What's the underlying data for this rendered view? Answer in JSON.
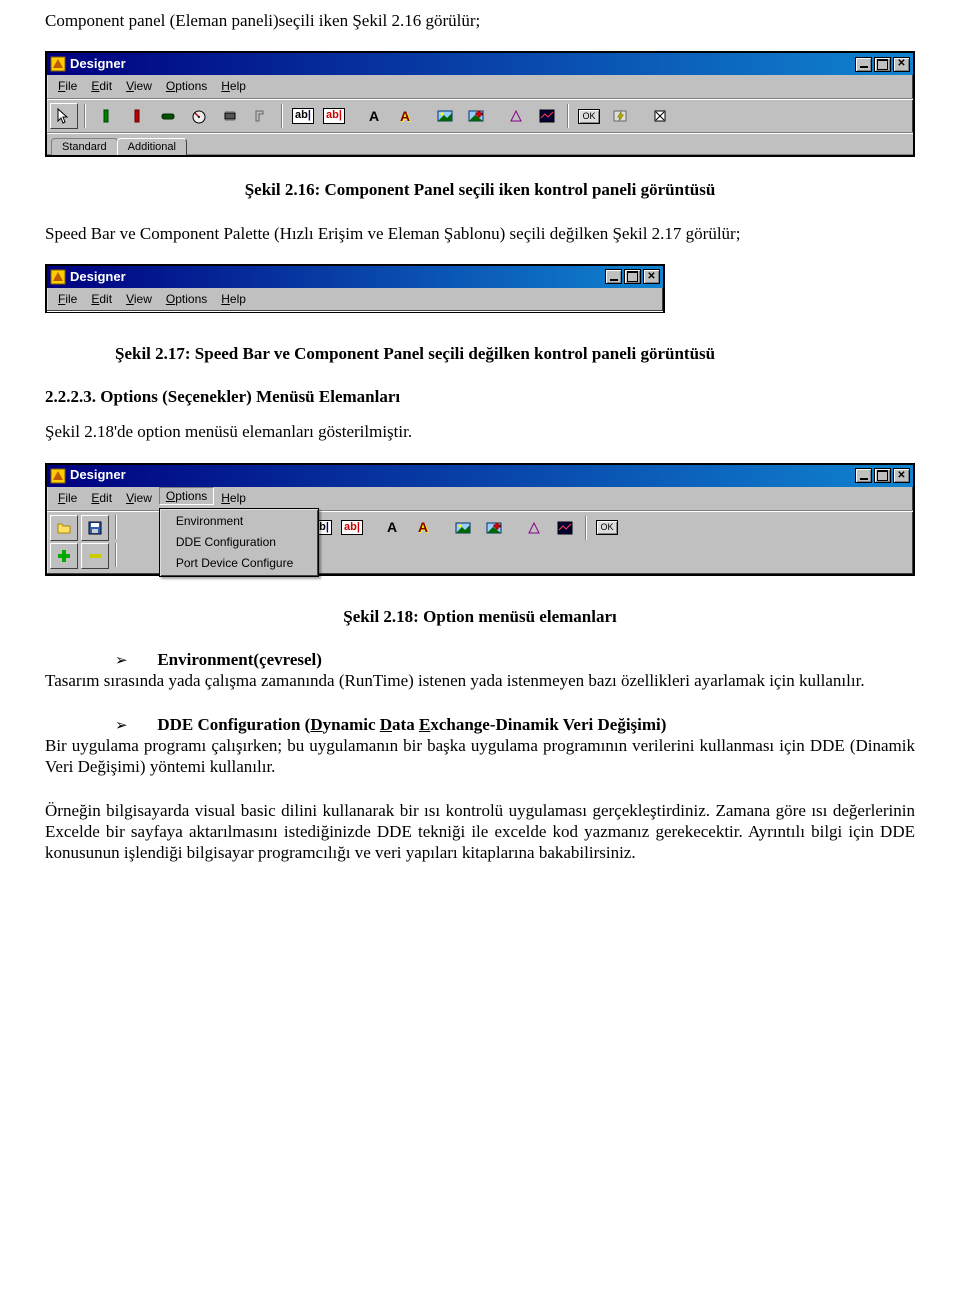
{
  "text": {
    "intro1": "Component panel (Eleman paneli)seçili iken Şekil 2.16 görülür;",
    "caption1": "Şekil 2.16: Component Panel  seçili iken kontrol paneli görüntüsü",
    "para2a": "Speed Bar ve Component  Palette (Hızlı Erişim  ve Eleman Şablonu) seçili     değilken Şekil 2.17 görülür;",
    "caption2": "Şekil 2.17: Speed Bar ve Component Panel  seçili değilken kontrol paneli görüntüsü",
    "heading223": "2.2.2.3.  Options (Seçenekler) Menüsü Elemanları",
    "para3": "Şekil 2.18'de option menüsü elemanları gösterilmiştir.",
    "caption3": "Şekil 2.18: Option menüsü elemanları",
    "env_label": "Environment(çevresel)",
    "env_body": "Tasarım sırasında yada çalışma zamanında (RunTime) istenen yada istenmeyen bazı özellikleri ayarlamak için kullanılır.",
    "dde_prefix": "DDE Configuration (",
    "dde_d": "D",
    "dde_mid1": "ynamic ",
    "dde_d2": "D",
    "dde_mid2": "ata ",
    "dde_e": "E",
    "dde_suffix": "xchange-Dinamik Veri Değişimi)",
    "dde_body": "Bir uygulama programı çalışırken; bu uygulamanın bir başka uygulama programının verilerini kullanması için DDE (Dinamik Veri Değişimi) yöntemi kullanılır.",
    "final": "Örneğin bilgisayarda visual basic dilini kullanarak bir ısı kontrolü uygulaması gerçekleştirdiniz. Zamana göre ısı değerlerinin Excelde bir sayfaya aktarılmasını istediğinizde DDE tekniği ile excelde kod yazmanız gerekecektir. Ayrıntılı bilgi için DDE konusunun işlendiği bilgisayar programcılığı ve veri yapıları kitaplarına bakabilirsiniz.",
    "bullet_glyph": "➢"
  },
  "app": {
    "title": "Designer",
    "menus": {
      "file_u": "F",
      "file": "ile",
      "edit_u": "E",
      "edit": "dit",
      "view_u": "V",
      "view": "iew",
      "options_u": "O",
      "options": "ptions",
      "help_u": "H",
      "help": "elp"
    },
    "tabs": {
      "standard": "Standard",
      "additional": "Additional"
    },
    "options_menu": {
      "env": "Environment",
      "dde": "DDE Configuration",
      "port": "Port Device Configure"
    }
  }
}
